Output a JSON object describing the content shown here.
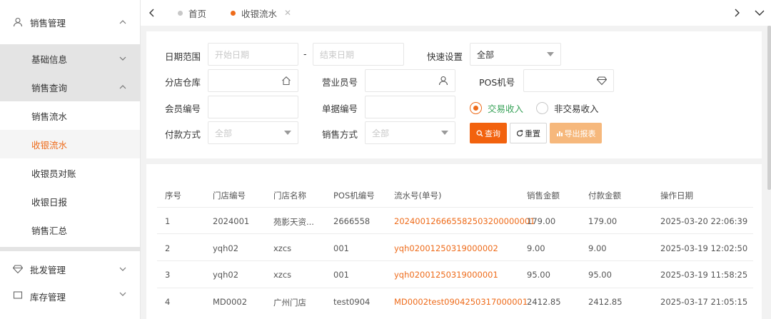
{
  "sidebar": {
    "sales": "销售管理",
    "basic": "基础信息",
    "query": "销售查询",
    "items": [
      "销售流水",
      "收银流水",
      "收银员对账",
      "收银日报",
      "销售汇总"
    ],
    "wholesale": "批发管理",
    "stock": "库存管理"
  },
  "tabs": {
    "home": "首页",
    "active": "收银流水"
  },
  "filter": {
    "date_label": "日期范围",
    "start_ph": "开始日期",
    "dash": "-",
    "end_ph": "结束日期",
    "quick_label": "快速设置",
    "quick_value": "全部",
    "branch_label": "分店仓库",
    "clerk_label": "营业员号",
    "pos_label": "POS机号",
    "member_label": "会员编号",
    "doc_label": "单据编号",
    "radio_on": "交易收入",
    "radio_off": "非交易收入",
    "pay_label": "付款方式",
    "pay_ph": "全部",
    "sale_label": "销售方式",
    "sale_ph": "全部",
    "btn_query": "查询",
    "btn_reset": "重置",
    "btn_export": "导出报表"
  },
  "table": {
    "headers": [
      "序号",
      "门店编号",
      "门店名称",
      "POS机编号",
      "流水号(单号)",
      "销售金额",
      "付款金额",
      "操作日期"
    ],
    "rows": [
      [
        "1",
        "2024001",
        "苑影天资...",
        "2666558",
        "202400126665582503200000001",
        "179.00",
        "179.00",
        "2025-03-20 22:06:39"
      ],
      [
        "2",
        "yqh02",
        "xzcs",
        "001",
        "yqh02001250319000002",
        "9.00",
        "9.00",
        "2025-03-19 12:02:50"
      ],
      [
        "3",
        "yqh02",
        "xzcs",
        "001",
        "yqh02001250319000001",
        "95.00",
        "95.00",
        "2025-03-19 11:58:25"
      ],
      [
        "4",
        "MD0002",
        "广州门店",
        "test0904",
        "MD0002test0904250317000001",
        "2412.85",
        "2412.85",
        "2025-03-17 21:05:15"
      ]
    ]
  },
  "colors": {
    "accent": "#ee6b1a",
    "green": "#3aa35a"
  }
}
